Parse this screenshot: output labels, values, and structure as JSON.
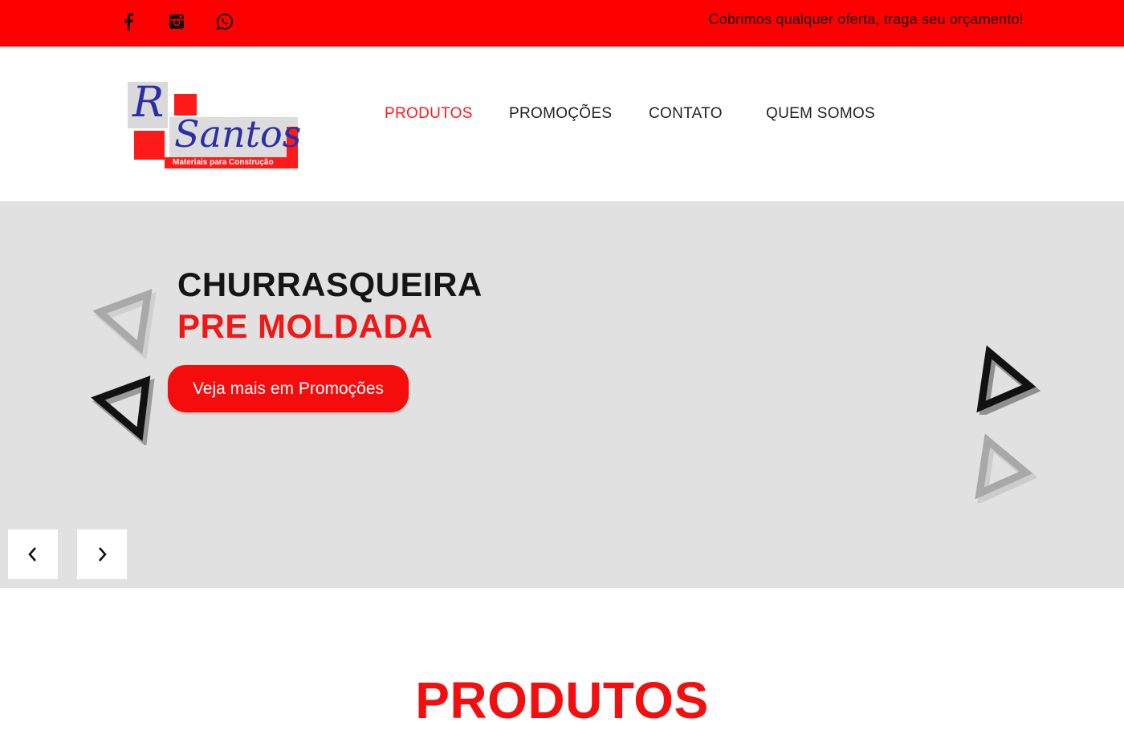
{
  "topbar": {
    "icons": [
      "facebook-icon",
      "instagram-icon",
      "whatsapp-icon"
    ],
    "tagline": "Cobrimos qualquer oferta, traga seu orçamento!",
    "background": "#ff0000"
  },
  "logo": {
    "letter": "R",
    "name": "Santos",
    "subtitle": "Materiais para Construção"
  },
  "nav": {
    "items": [
      {
        "label": "PRODUTOS",
        "active": true
      },
      {
        "label": "PROMOÇÕES",
        "active": false
      },
      {
        "label": "CONTATO",
        "active": false
      },
      {
        "label": "QUEM SOMOS",
        "active": false
      }
    ]
  },
  "hero": {
    "line1": "CHURRASQUEIRA",
    "line2": "PRE MOLDADA",
    "button_label": "Veja mais em Promoções",
    "prev_icon": "chevron-left-icon",
    "next_icon": "chevron-right-icon"
  },
  "section": {
    "title": "PRODUTOS"
  },
  "colors": {
    "accent": "#ff0000",
    "hero_background": "#e1e1e1",
    "logo_blue": "#2b2ea6"
  }
}
